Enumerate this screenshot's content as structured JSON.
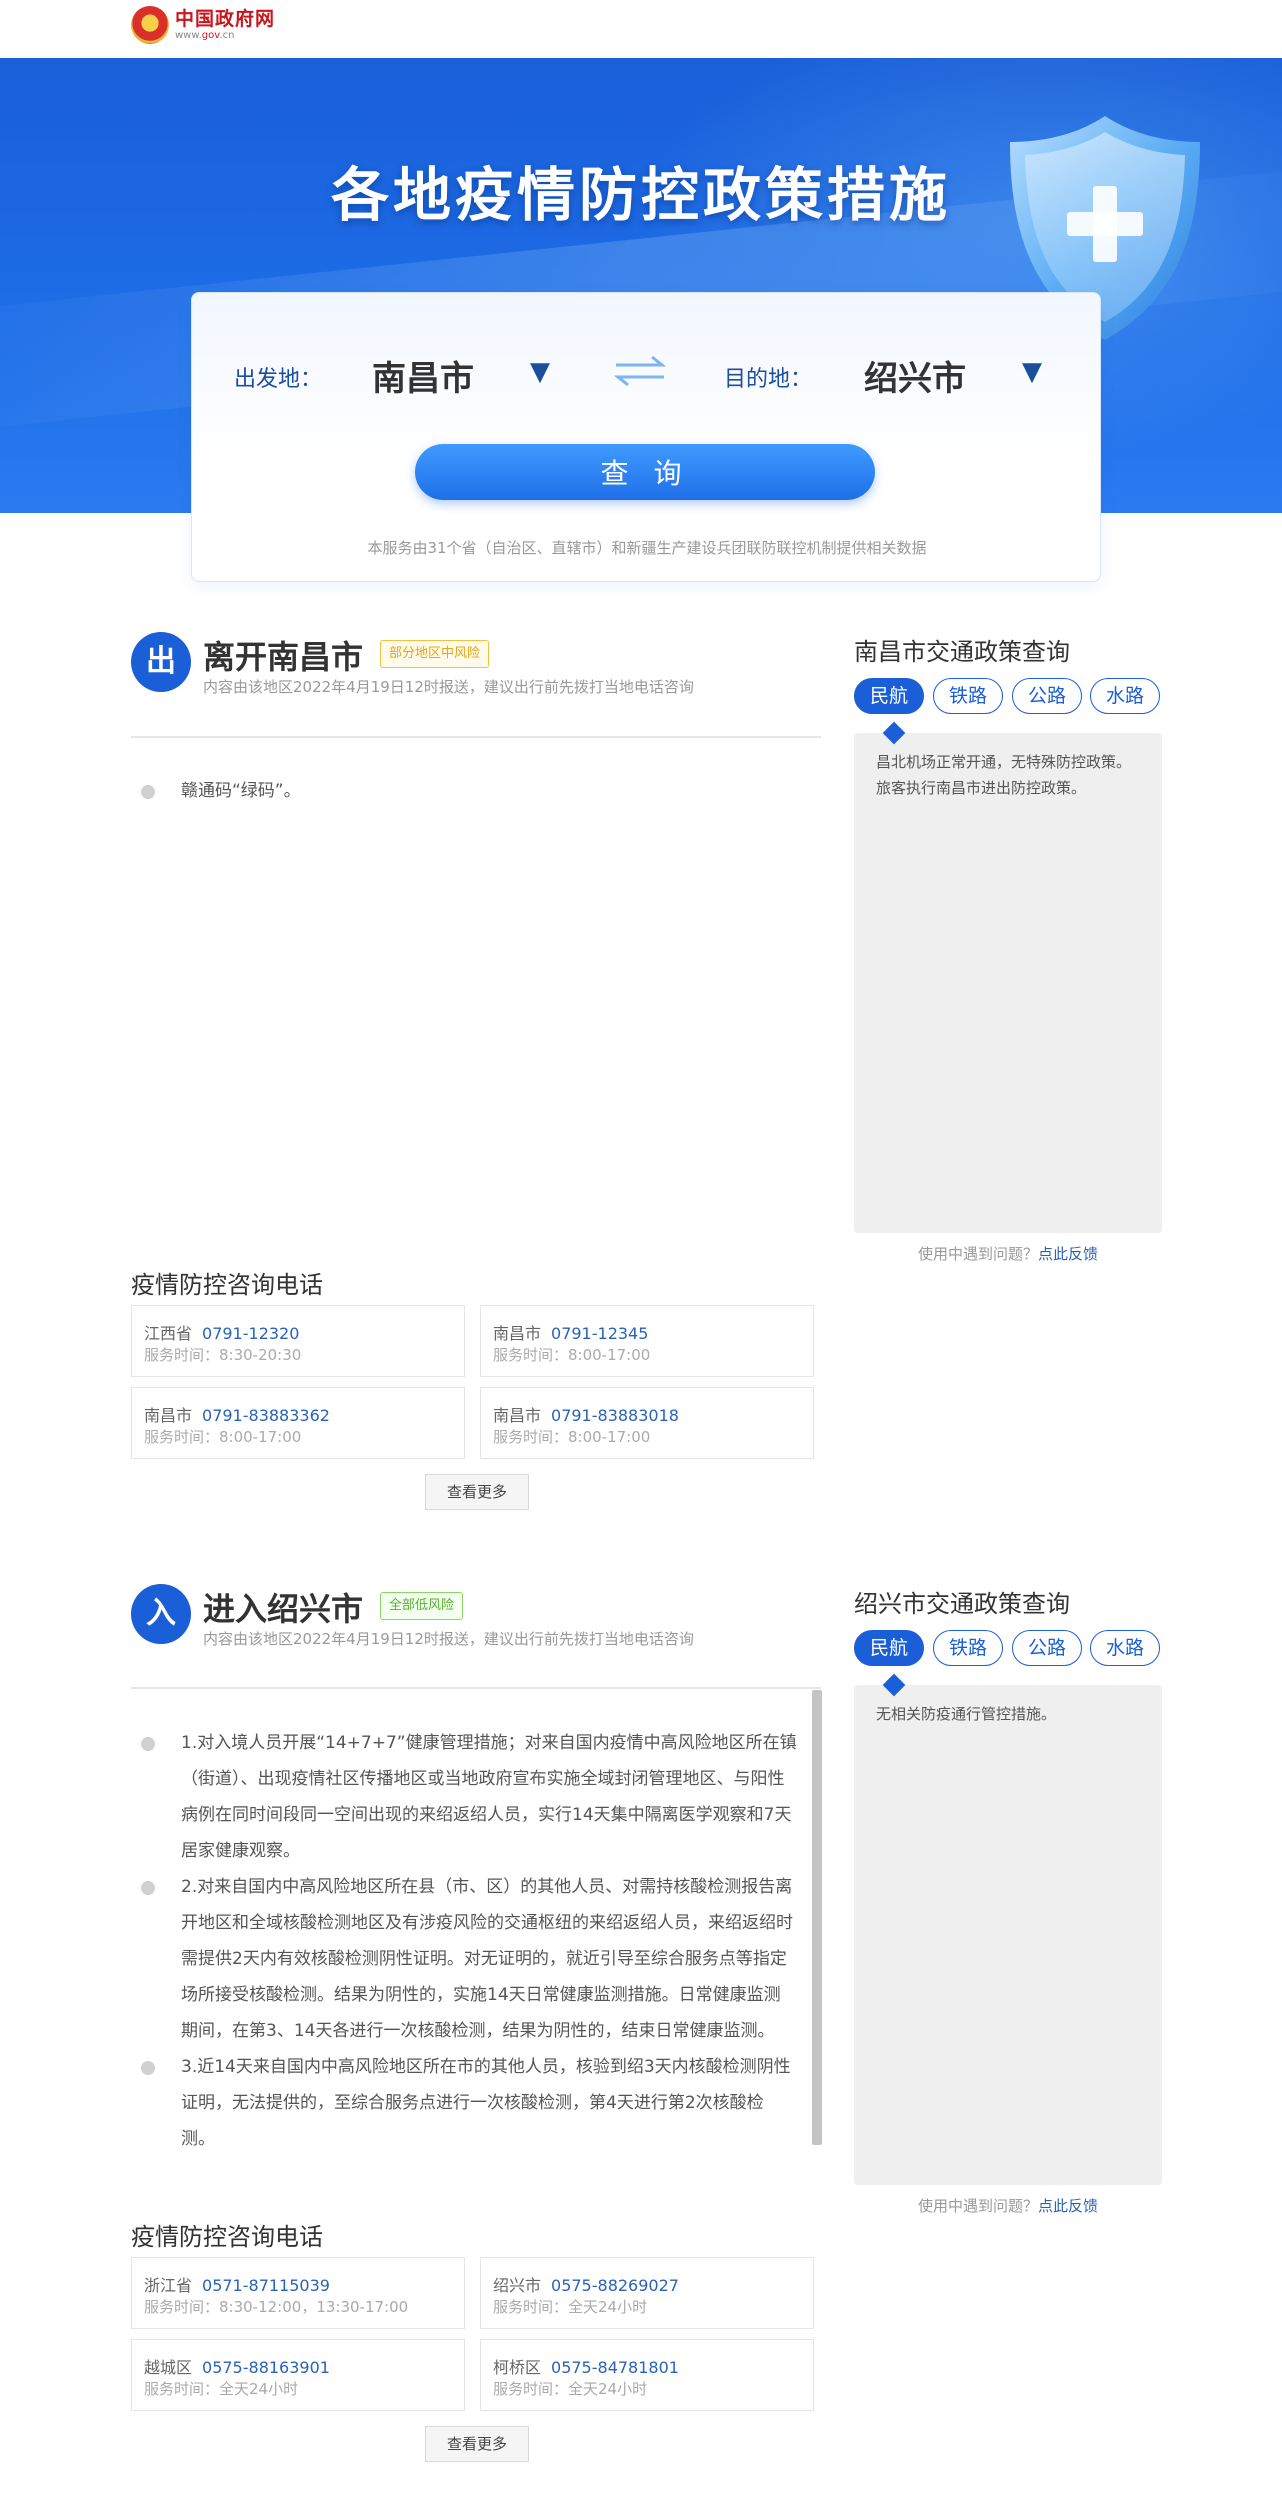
{
  "header": {
    "site_name": "中国政府网",
    "site_url_prefix": "www.",
    "site_url_mid": "gov",
    "site_url_suffix": ".cn"
  },
  "banner": {
    "title": "各地疫情防控政策措施"
  },
  "search": {
    "from_label": "出发地：",
    "from_value": "南昌市",
    "to_label": "目的地：",
    "to_value": "绍兴市",
    "caret": "▼",
    "query_label": "查 询",
    "note": "本服务由31个省（自治区、直辖市）和新疆生产建设兵团联防联控机制提供相关数据"
  },
  "colors": {
    "brand_blue": "#1a5fd8",
    "gov_red": "#c8161d",
    "risk_yellow": "#e8a418",
    "risk_green": "#53b22a"
  },
  "leave": {
    "icon_text": "出",
    "title": "离开南昌市",
    "risk": "部分地区中风险",
    "subtitle": "内容由该地区2022年4月19日12时报送，建议出行前先拨打当地电话咨询",
    "items": [
      "赣通码“绿码”。"
    ],
    "phones_title": "疫情防控咨询电话",
    "phones": [
      {
        "area": "江西省",
        "number": "0791-12320",
        "hours": "服务时间：8:30-20:30"
      },
      {
        "area": "南昌市",
        "number": "0791-12345",
        "hours": "服务时间：8:00-17:00"
      },
      {
        "area": "南昌市",
        "number": "0791-83883362",
        "hours": "服务时间：8:00-17:00"
      },
      {
        "area": "南昌市",
        "number": "0791-83883018",
        "hours": "服务时间：8:00-17:00"
      }
    ],
    "more_label": "查看更多"
  },
  "leave_side": {
    "title": "南昌市交通政策查询",
    "tabs": [
      "民航",
      "铁路",
      "公路",
      "水路"
    ],
    "active_tab": "民航",
    "content": "昌北机场正常开通，无特殊防控政策。旅客执行南昌市进出防控政策。",
    "feedback_text": "使用中遇到问题？",
    "feedback_link": "点此反馈"
  },
  "enter": {
    "icon_text": "入",
    "title": "进入绍兴市",
    "risk": "全部低风险",
    "subtitle": "内容由该地区2022年4月19日12时报送，建议出行前先拨打当地电话咨询",
    "items": [
      "1.对入境人员开展“14+7+7”健康管理措施；对来自国内疫情中高风险地区所在镇（街道）、出现疫情社区传播地区或当地政府宣布实施全域封闭管理地区、与阳性病例在同时间段同一空间出现的来绍返绍人员，实行14天集中隔离医学观察和7天居家健康观察。",
      "2.对来自国内中高风险地区所在县（市、区）的其他人员、对需持核酸检测报告离开地区和全域核酸检测地区及有涉疫风险的交通枢纽的来绍返绍人员，来绍返绍时需提供2天内有效核酸检测阴性证明。对无证明的，就近引导至综合服务点等指定场所接受核酸检测。结果为阴性的，实施14天日常健康监测措施。日常健康监测期间，在第3、14天各进行一次核酸检测，结果为阴性的，结束日常健康监测。",
      "3.近14天来自国内中高风险地区所在市的其他人员，核验到绍3天内核酸检测阴性证明，无法提供的，至综合服务点进行一次核酸检测，第4天进行第2次核酸检测。"
    ],
    "phones_title": "疫情防控咨询电话",
    "phones": [
      {
        "area": "浙江省",
        "number": "0571-87115039",
        "hours": "服务时间：8:30-12:00，13:30-17:00"
      },
      {
        "area": "绍兴市",
        "number": "0575-88269027",
        "hours": "服务时间：全天24小时"
      },
      {
        "area": "越城区",
        "number": "0575-88163901",
        "hours": "服务时间：全天24小时"
      },
      {
        "area": "柯桥区",
        "number": "0575-84781801",
        "hours": "服务时间：全天24小时"
      }
    ],
    "more_label": "查看更多"
  },
  "enter_side": {
    "title": "绍兴市交通政策查询",
    "tabs": [
      "民航",
      "铁路",
      "公路",
      "水路"
    ],
    "active_tab": "民航",
    "content": "无相关防疫通行管控措施。",
    "feedback_text": "使用中遇到问题？",
    "feedback_link": "点此反馈"
  }
}
